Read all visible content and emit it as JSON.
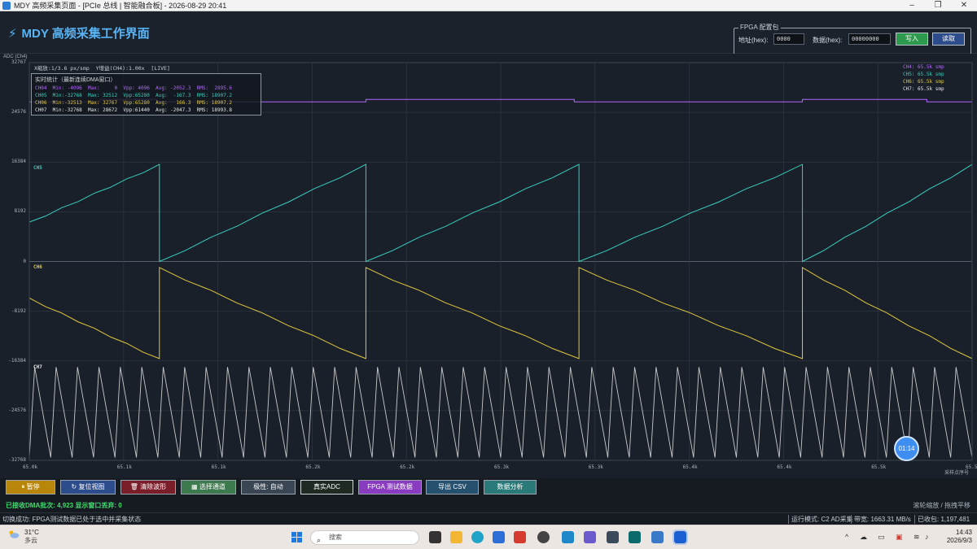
{
  "window": {
    "title": "MDY 高频采集页面 - [PCIe 总线 | 智能融合板] - 2026-08-29 20:41",
    "minimize": "–",
    "maximize": "❐",
    "close": "✕"
  },
  "header": {
    "app_title": "MDY 高频采集工作界面",
    "fpga": {
      "legend": "FPGA 配置包",
      "addr_label": "地址(hex):",
      "addr_value": "0000",
      "data_label": "数据(hex):",
      "data_value": "00000000",
      "write_label": "写入",
      "read_label": "读取",
      "write_color": "#2e9a4e",
      "read_color": "#2c4c8c"
    }
  },
  "plot": {
    "y_axis_name": "ADC (Ch4)",
    "x_axis_name": "采样点序号",
    "info_line": "X缩放:1/3.6 px/smp  Y增益(CH4):1.00x  [LIVE]",
    "stats_title": "实时统计（最新连续DMA窗口）",
    "stats_rows": [
      {
        "text": "CH04  Min: -4096  Max:     0  Vpp: 4096  Avg: -2052.3  RMS:  2895.6",
        "color": "#b266ff"
      },
      {
        "text": "CH05  Min:-32768  Max: 32512  Vpp:65280  Avg:  -167.3  RMS: 18907.2",
        "color": "#38d0c0"
      },
      {
        "text": "CH06  Min:-32513  Max: 32767  Vpp:65280  Avg:   166.3  RMS: 18907.2",
        "color": "#e0c840"
      },
      {
        "text": "CH07  Min:-32768  Max: 28672  Vpp:61440  Avg: -2047.3  RMS: 18993.8",
        "color": "#e6e6e6"
      }
    ],
    "legend_right": [
      {
        "text": "CH4: 65.5k smp",
        "color": "#b266ff"
      },
      {
        "text": "CH5: 65.5k smp",
        "color": "#38d0c0"
      },
      {
        "text": "CH6: 65.5k smp",
        "color": "#e0c840"
      },
      {
        "text": "CH7: 65.5k smp",
        "color": "#e6e6e6"
      }
    ],
    "channel_labels": [
      {
        "text": "CH5",
        "color": "#38d0c0"
      },
      {
        "text": "CH6",
        "color": "#e0c840"
      },
      {
        "text": "CH7",
        "color": "#e6e6e6"
      }
    ],
    "y_ticks": [
      "32767",
      "24576",
      "16384",
      "8192",
      "0",
      "-8192",
      "-16384",
      "-24576",
      "-32768"
    ],
    "x_ticks": [
      "65.0k",
      "65.1k",
      "65.1k",
      "65.2k",
      "65.2k",
      "65.3k",
      "65.3k",
      "65.4k",
      "65.4k",
      "65.5k",
      "65.5"
    ],
    "timer": "01:14"
  },
  "chart_data": {
    "type": "line",
    "ylabel": "ADC (Ch4)",
    "xlabel": "采样点序号",
    "ylim": [
      -32768,
      32767
    ],
    "grid": true,
    "legend": "top-right",
    "series": [
      {
        "name": "CH4",
        "color": "#b266ff",
        "values_desc": "square wave between 0 and -4096",
        "min": -4096,
        "max": 0
      },
      {
        "name": "CH5",
        "color": "#38d0c0",
        "min": -32768,
        "max": 32512
      },
      {
        "name": "CH6",
        "color": "#e0c840",
        "min": -32513,
        "max": 32767
      },
      {
        "name": "CH7",
        "color": "#e6e6e6",
        "min": -32768,
        "max": 28672
      }
    ]
  },
  "buttons": [
    {
      "label": "⏸ 暂停",
      "bg": "#b8860b"
    },
    {
      "label": "↻ 复位视图",
      "bg": "#2c4c8c"
    },
    {
      "label": "🗑 清除波形",
      "bg": "#7a1f2a"
    },
    {
      "label": "▦ 选择通道",
      "bg": "#3d7a4e"
    },
    {
      "label": "极性: 自动",
      "bg": "#3a4654"
    },
    {
      "label": "真实ADC",
      "bg": "#1f2a22"
    },
    {
      "label": "FPGA 测试数据",
      "bg": "#8a3cc0"
    },
    {
      "label": "导出 CSV",
      "bg": "#25506e"
    },
    {
      "label": "数据分析",
      "bg": "#2a7a7a"
    }
  ],
  "hint_right": "滚轮缩放 / 拖拽平移",
  "dma_status": "已接收DMA批次: 4,923   显示窗口丢弃: 0",
  "statusbar": {
    "message": "切换成功: FPGA测试数据已处于选中并采集状态",
    "mode": "运行模式: C2 AD采集",
    "bandwidth": "带宽: 1663.31 MB/s",
    "received": "已收包: 1,197,481"
  },
  "taskbar": {
    "temp": "31°C",
    "weather": "多云",
    "search": "搜索",
    "time": "14:43",
    "date": "2026/9/3"
  }
}
